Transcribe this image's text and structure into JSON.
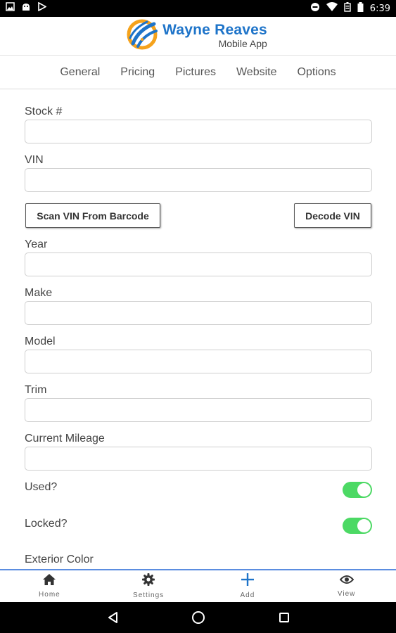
{
  "status_bar": {
    "time": "6:39",
    "left_icons": [
      "gallery-icon",
      "android-icon",
      "play-store-icon"
    ],
    "right_icons": [
      "do-not-disturb-icon",
      "wifi-icon",
      "battery-saver-icon",
      "battery-icon"
    ]
  },
  "header": {
    "app_title": "Wayne Reaves",
    "app_subtitle": "Mobile App",
    "logo_icon": "wayne-reaves-logo",
    "colors": {
      "title": "#1e74c9",
      "logo_blue": "#1e74c9",
      "logo_orange": "#f5a21b"
    }
  },
  "tabs": [
    {
      "label": "General"
    },
    {
      "label": "Pricing"
    },
    {
      "label": "Pictures"
    },
    {
      "label": "Website"
    },
    {
      "label": "Options"
    }
  ],
  "form": {
    "stock": {
      "label": "Stock #",
      "value": ""
    },
    "vin": {
      "label": "VIN",
      "value": ""
    },
    "scan_button": "Scan VIN From Barcode",
    "decode_button": "Decode VIN",
    "year": {
      "label": "Year",
      "value": ""
    },
    "make": {
      "label": "Make",
      "value": ""
    },
    "model": {
      "label": "Model",
      "value": ""
    },
    "trim": {
      "label": "Trim",
      "value": ""
    },
    "mileage": {
      "label": "Current Mileage",
      "value": ""
    },
    "used": {
      "label": "Used?",
      "on": true
    },
    "locked": {
      "label": "Locked?",
      "on": true
    },
    "exterior_color": {
      "label": "Exterior Color"
    },
    "toggle_color": "#4cd964"
  },
  "bottom_nav": {
    "items": [
      {
        "label": "Home",
        "icon": "home-icon"
      },
      {
        "label": "Settings",
        "icon": "gear-icon"
      },
      {
        "label": "Add",
        "icon": "plus-icon",
        "color": "#1e74c9"
      },
      {
        "label": "View",
        "icon": "eye-icon"
      }
    ],
    "border_color": "#5b8de0"
  },
  "system_nav": [
    "back-icon",
    "home-circle-icon",
    "recents-icon"
  ]
}
